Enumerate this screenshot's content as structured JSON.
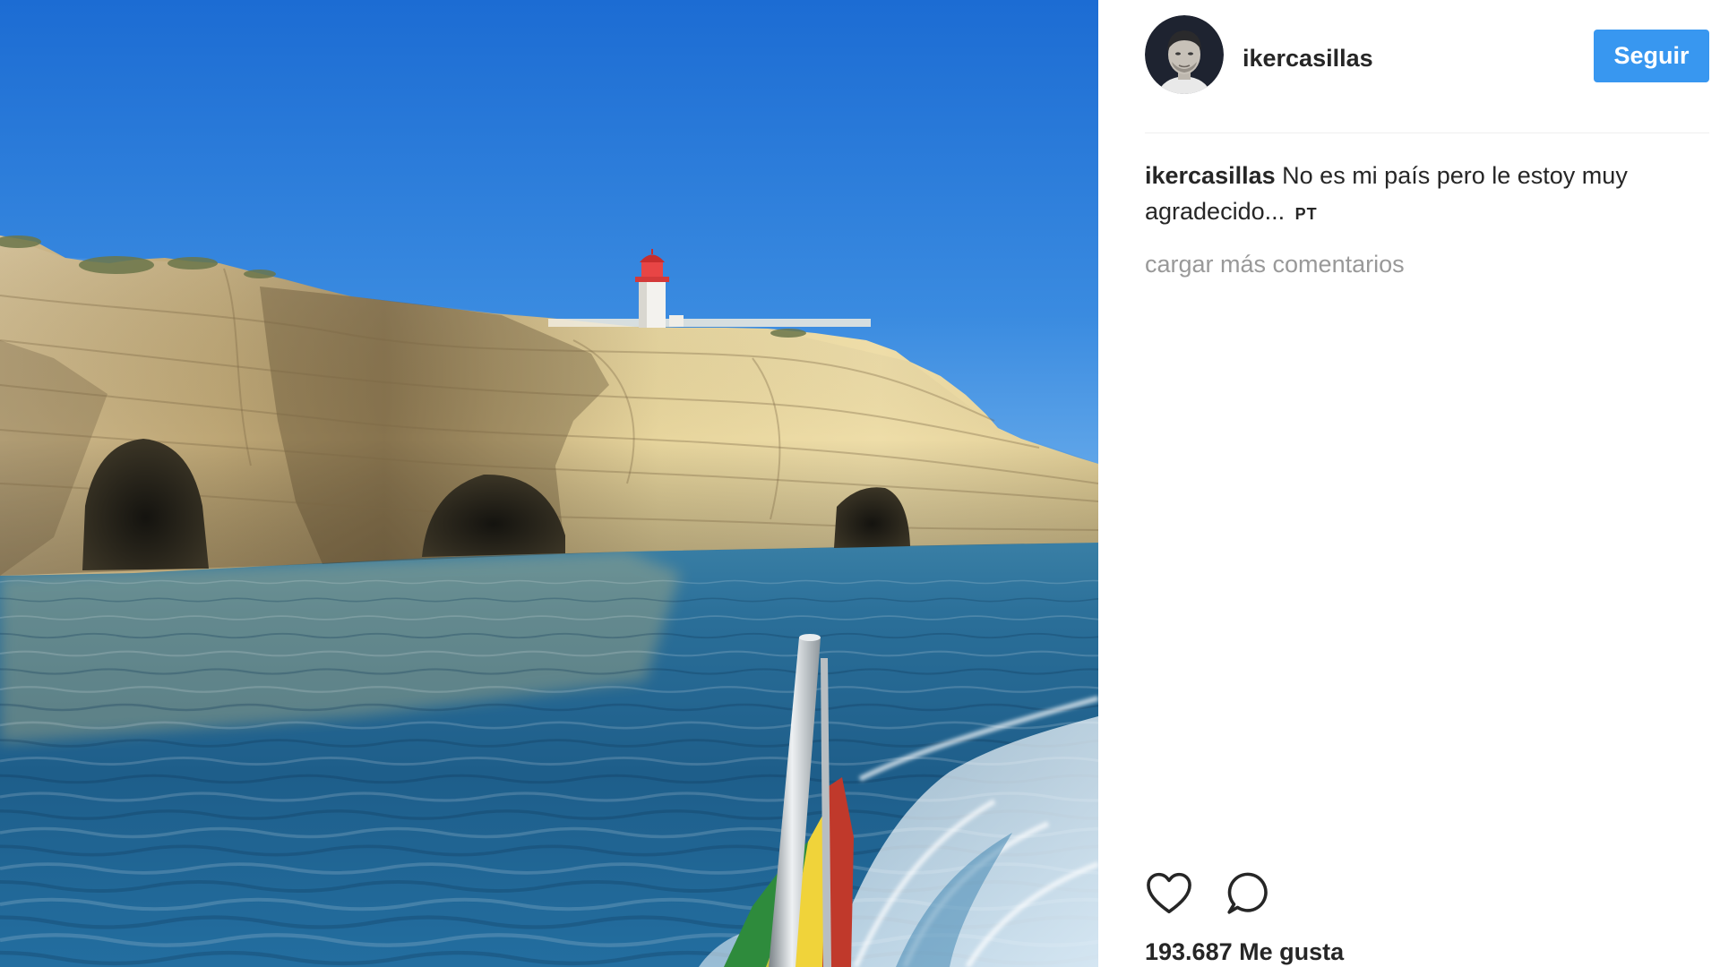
{
  "profile": {
    "username": "ikercasillas",
    "follow_label": "Seguir",
    "avatar_icon": "avatar"
  },
  "caption": {
    "username": "ikercasillas",
    "text": "No es mi país pero le estoy muy agradecido...",
    "tag": "PT"
  },
  "comments": {
    "load_more_label": "cargar más comentarios"
  },
  "actions": {
    "like_icon": "heart-icon",
    "comment_icon": "comment-icon"
  },
  "likes": {
    "label": "193.687 Me gusta"
  },
  "colors": {
    "follow_button": "#3897f0",
    "text": "#262626",
    "muted": "#999999",
    "divider": "#efefef"
  }
}
